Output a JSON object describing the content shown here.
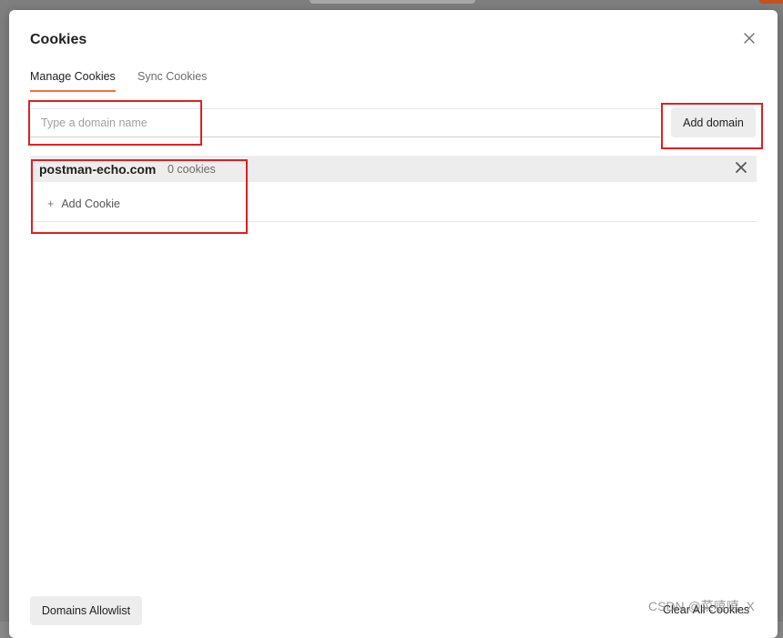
{
  "dialog": {
    "title": "Cookies",
    "tabs": [
      {
        "label": "Manage Cookies",
        "active": true
      },
      {
        "label": "Sync Cookies",
        "active": false
      }
    ]
  },
  "domain_input": {
    "placeholder": "Type a domain name",
    "value": ""
  },
  "add_domain_label": "Add domain",
  "domains": [
    {
      "name": "postman-echo.com",
      "count_label": "0 cookies",
      "add_cookie_label": "Add Cookie"
    }
  ],
  "footer": {
    "allowlist_label": "Domains Allowlist",
    "clear_all_label": "Clear All Cookies"
  },
  "watermark": "CSDN @菜嘻嘻_X",
  "colors": {
    "accent_tab": "#ff6c37",
    "annotation_red": "#e02020",
    "row_background": "#ededed"
  },
  "icons": {
    "close": "close-icon",
    "delete_domain": "close-icon",
    "add_cookie": "plus-icon"
  }
}
